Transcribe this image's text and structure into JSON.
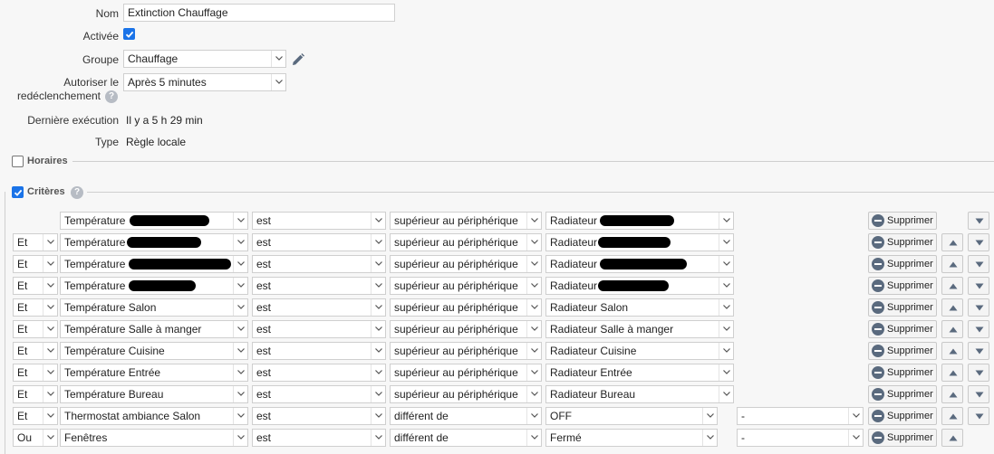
{
  "form": {
    "name_label": "Nom",
    "name_value": "Extinction Chauffage",
    "active_label": "Activée",
    "active_checked": true,
    "group_label": "Groupe",
    "group_value": "Chauffage",
    "retrigger_label_1": "Autoriser le",
    "retrigger_label_2": "redéclenchement",
    "retrigger_value": "Après 5 minutes",
    "last_run_label": "Dernière exécution",
    "last_run_value": "Il y a 5 h 29 min",
    "type_label": "Type",
    "type_value": "Règle locale",
    "help_glyph": "?"
  },
  "sections": {
    "horaires_label": "Horaires",
    "horaires_checked": false,
    "criteres_label": "Critères",
    "criteres_checked": true
  },
  "delete_label": "Supprimer",
  "criteria": [
    {
      "conj": "",
      "device": "Température ",
      "op": "est",
      "cmp": "supérieur au périphérique",
      "target": "Radiateur ",
      "value": ""
    },
    {
      "conj": "Et",
      "device": "Température ",
      "op": "est",
      "cmp": "supérieur au périphérique",
      "target": "Radiateur ",
      "value": ""
    },
    {
      "conj": "Et",
      "device": "Température ",
      "op": "est",
      "cmp": "supérieur au périphérique",
      "target": "Radiateur ",
      "value": ""
    },
    {
      "conj": "Et",
      "device": "Température ",
      "op": "est",
      "cmp": "supérieur au périphérique",
      "target": "Radiateur ",
      "value": ""
    },
    {
      "conj": "Et",
      "device": "Température Salon",
      "op": "est",
      "cmp": "supérieur au périphérique",
      "target": "Radiateur Salon",
      "value": ""
    },
    {
      "conj": "Et",
      "device": "Température Salle à manger",
      "op": "est",
      "cmp": "supérieur au périphérique",
      "target": "Radiateur Salle à manger",
      "value": ""
    },
    {
      "conj": "Et",
      "device": "Température Cuisine",
      "op": "est",
      "cmp": "supérieur au périphérique",
      "target": "Radiateur Cuisine",
      "value": ""
    },
    {
      "conj": "Et",
      "device": "Température Entrée",
      "op": "est",
      "cmp": "supérieur au périphérique",
      "target": "Radiateur Entrée",
      "value": ""
    },
    {
      "conj": "Et",
      "device": "Température Bureau",
      "op": "est",
      "cmp": "supérieur au périphérique",
      "target": "Radiateur Bureau",
      "value": ""
    },
    {
      "conj": "Et",
      "device": "Thermostat ambiance Salon",
      "op": "est",
      "cmp": "différent de",
      "target": "OFF",
      "value": "-"
    },
    {
      "conj": "Ou",
      "device": "Fenêtres",
      "op": "est",
      "cmp": "différent de",
      "target": "Fermé",
      "value": "-"
    }
  ]
}
